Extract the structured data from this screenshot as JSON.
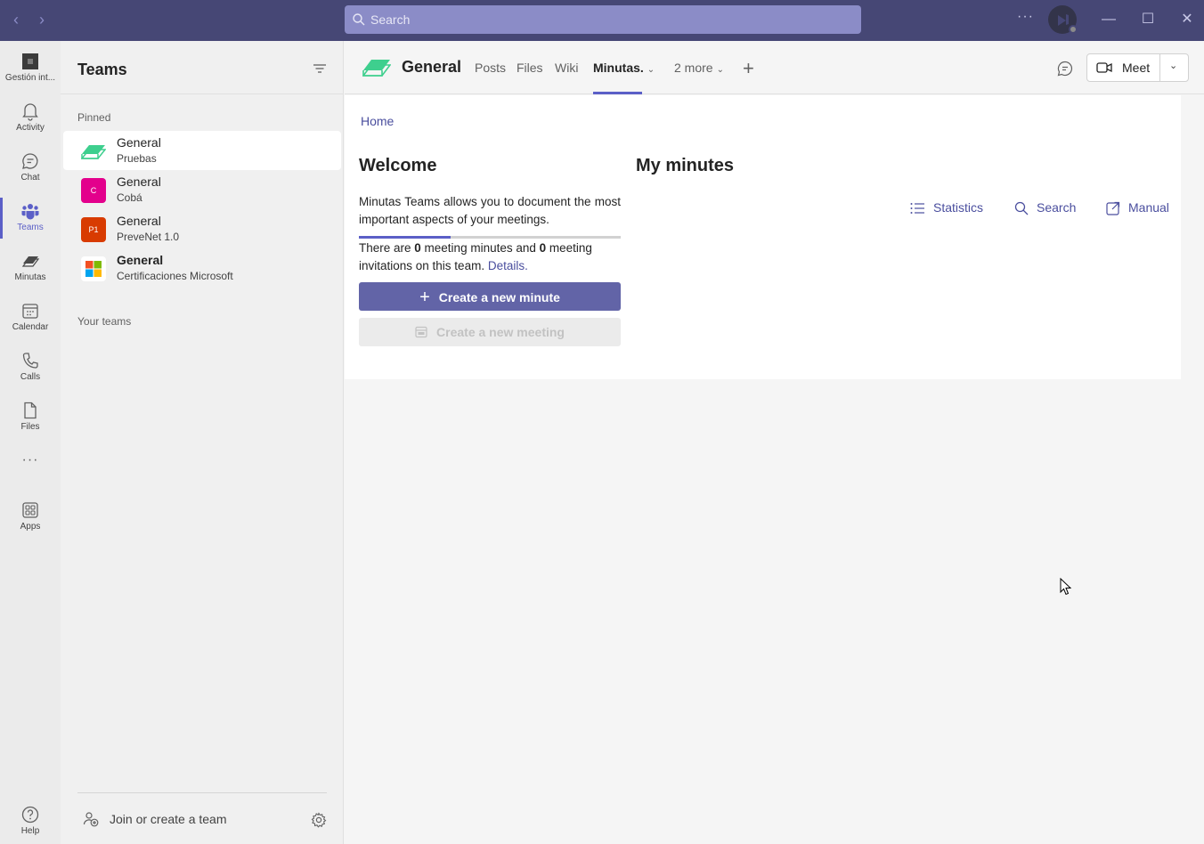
{
  "titlebar": {
    "back_icon": "chevron-left-icon",
    "forward_icon": "chevron-right-icon",
    "search_placeholder": "Search",
    "more_label": "···",
    "colors": {
      "background": "#464775",
      "search": "#8b8cc7"
    }
  },
  "rail": {
    "items": [
      {
        "label": "Gestión int...",
        "icon": "org-app-icon"
      },
      {
        "label": "Activity",
        "icon": "bell-icon"
      },
      {
        "label": "Chat",
        "icon": "chat-icon"
      },
      {
        "label": "Teams",
        "icon": "teams-icon",
        "active": true
      },
      {
        "label": "Minutas",
        "icon": "minutas-icon"
      },
      {
        "label": "Calendar",
        "icon": "calendar-icon"
      },
      {
        "label": "Calls",
        "icon": "phone-icon"
      },
      {
        "label": "Files",
        "icon": "file-icon"
      },
      {
        "label": "···",
        "icon": "more-icon"
      },
      {
        "label": "Apps",
        "icon": "apps-icon"
      },
      {
        "label": "Help",
        "icon": "help-icon"
      }
    ]
  },
  "teams_pane": {
    "title": "Teams",
    "pinned_label": "Pinned",
    "your_teams_label": "Your teams",
    "pinned": [
      {
        "channel": "General",
        "team": "Pruebas",
        "avatar": "minutas-logo",
        "selected": true
      },
      {
        "channel": "General",
        "team": "Cobá",
        "avatar_text": "C",
        "avatar_color": "#e3008c"
      },
      {
        "channel": "General",
        "team": "PreveNet 1.0",
        "avatar_text": "P1",
        "avatar_color": "#d83b01"
      },
      {
        "channel": "General",
        "team": "Certificaciones Microsoft",
        "avatar": "microsoft-logo",
        "bold": true
      }
    ],
    "join_label": "Join or create a team"
  },
  "channel_header": {
    "title": "General",
    "tabs": [
      {
        "label": "Posts"
      },
      {
        "label": "Files"
      },
      {
        "label": "Wiki"
      },
      {
        "label": "Minutas.",
        "active": true,
        "dropdown": true
      },
      {
        "label": "2 more",
        "dropdown": true
      }
    ],
    "meet_label": "Meet",
    "accent": "#5b5fc7"
  },
  "content": {
    "breadcrumb": "Home",
    "welcome_title": "Welcome",
    "welcome_text": "Minutas Teams allows you to document the most important aspects of your meetings.",
    "progress_fraction": 0.35,
    "stats": {
      "prefix": "There are ",
      "minutes_count": "0",
      "middle": " meeting minutes and ",
      "invitations_count": "0",
      "suffix": " meeting invitations on this team. ",
      "details_link": "Details."
    },
    "create_minute_label": "Create a new minute",
    "create_meeting_label": "Create a new meeting",
    "my_minutes_title": "My minutes",
    "actions": [
      {
        "label": "Statistics",
        "icon": "list-icon"
      },
      {
        "label": "Search",
        "icon": "search-icon"
      },
      {
        "label": "Manual",
        "icon": "open-external-icon"
      }
    ]
  }
}
